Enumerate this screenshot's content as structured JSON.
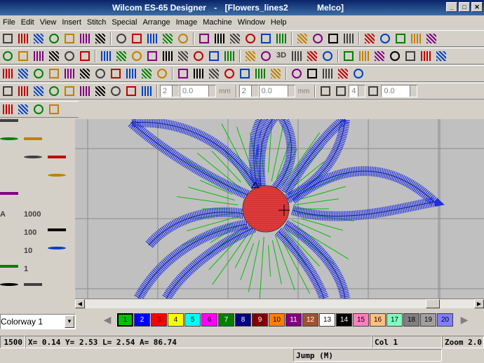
{
  "window": {
    "app_name": "Wilcom ES-65 Designer",
    "document": "[Flowers_lines2",
    "machine": "Melco]"
  },
  "menu": [
    "File",
    "Edit",
    "View",
    "Insert",
    "Stitch",
    "Special",
    "Arrange",
    "Image",
    "Machine",
    "Window",
    "Help"
  ],
  "toolbar": {
    "row1_icons": [
      "new-icon",
      "open-icon",
      "save-icon",
      "print-icon",
      "print-preview-icon",
      "sew-out-icon",
      "cut-icon",
      "copy-icon",
      "paste-icon",
      "delete-icon",
      "undo-icon",
      "redo-icon",
      "group-icon",
      "ungroup-icon",
      "lock-icon",
      "unlock-icon",
      "select-object-icon",
      "reshape-icon",
      "knife-icon",
      "outline-icon",
      "grid-icon",
      "show-stitches-icon",
      "show-outlines-icon",
      "show-bitmap-icon",
      "zoom-box-icon",
      "zoom-in-icon",
      "zoom-out-icon"
    ],
    "row2_icons": [
      "satin-icon",
      "tatami-icon",
      "fancy-fill-icon",
      "step-icon",
      "run-icon",
      "motif-fill-icon",
      "lettering-icon",
      "3d-icon",
      "perspective-icon",
      "effects-icon"
    ],
    "row2_label_3d": "3D",
    "spin_values": [
      "2",
      "0.0",
      "2",
      "0.0",
      "4",
      "0.0"
    ],
    "units": [
      "mm",
      "mm"
    ]
  },
  "colorway": {
    "label": "Colorway 1",
    "swatches": [
      {
        "n": "1",
        "color": "#00c000",
        "selected": true
      },
      {
        "n": "2",
        "color": "#0000ff"
      },
      {
        "n": "3",
        "color": "#ff0000"
      },
      {
        "n": "4",
        "color": "#ffff00"
      },
      {
        "n": "5",
        "color": "#00ffff"
      },
      {
        "n": "6",
        "color": "#ff00ff"
      },
      {
        "n": "7",
        "color": "#008000"
      },
      {
        "n": "8",
        "color": "#000080"
      },
      {
        "n": "9",
        "color": "#800000"
      },
      {
        "n": "10",
        "color": "#ff8000"
      },
      {
        "n": "11",
        "color": "#800080"
      },
      {
        "n": "12",
        "color": "#a0522d"
      },
      {
        "n": "13",
        "color": "#ffffff"
      },
      {
        "n": "14",
        "color": "#000000"
      },
      {
        "n": "15",
        "color": "#ff80c0"
      },
      {
        "n": "16",
        "color": "#ffc080"
      },
      {
        "n": "17",
        "color": "#80ffc0"
      },
      {
        "n": "18",
        "color": "#808080"
      },
      {
        "n": "19",
        "color": "#a0a0a0"
      },
      {
        "n": "20",
        "color": "#8080ff"
      }
    ]
  },
  "status": {
    "stitch_count": "1500",
    "coords": "X=   0.14 Y=   2.53 L=   2.54 A=  86.74",
    "color": "Col 1",
    "zoom": "Zoom 2.0",
    "mode": "Jump (M)"
  },
  "colors": {
    "stitch_blue": "#2030e0",
    "jump_green": "#00c000",
    "center_red": "#e04040",
    "canvas_bg": "#c0c0c0"
  }
}
